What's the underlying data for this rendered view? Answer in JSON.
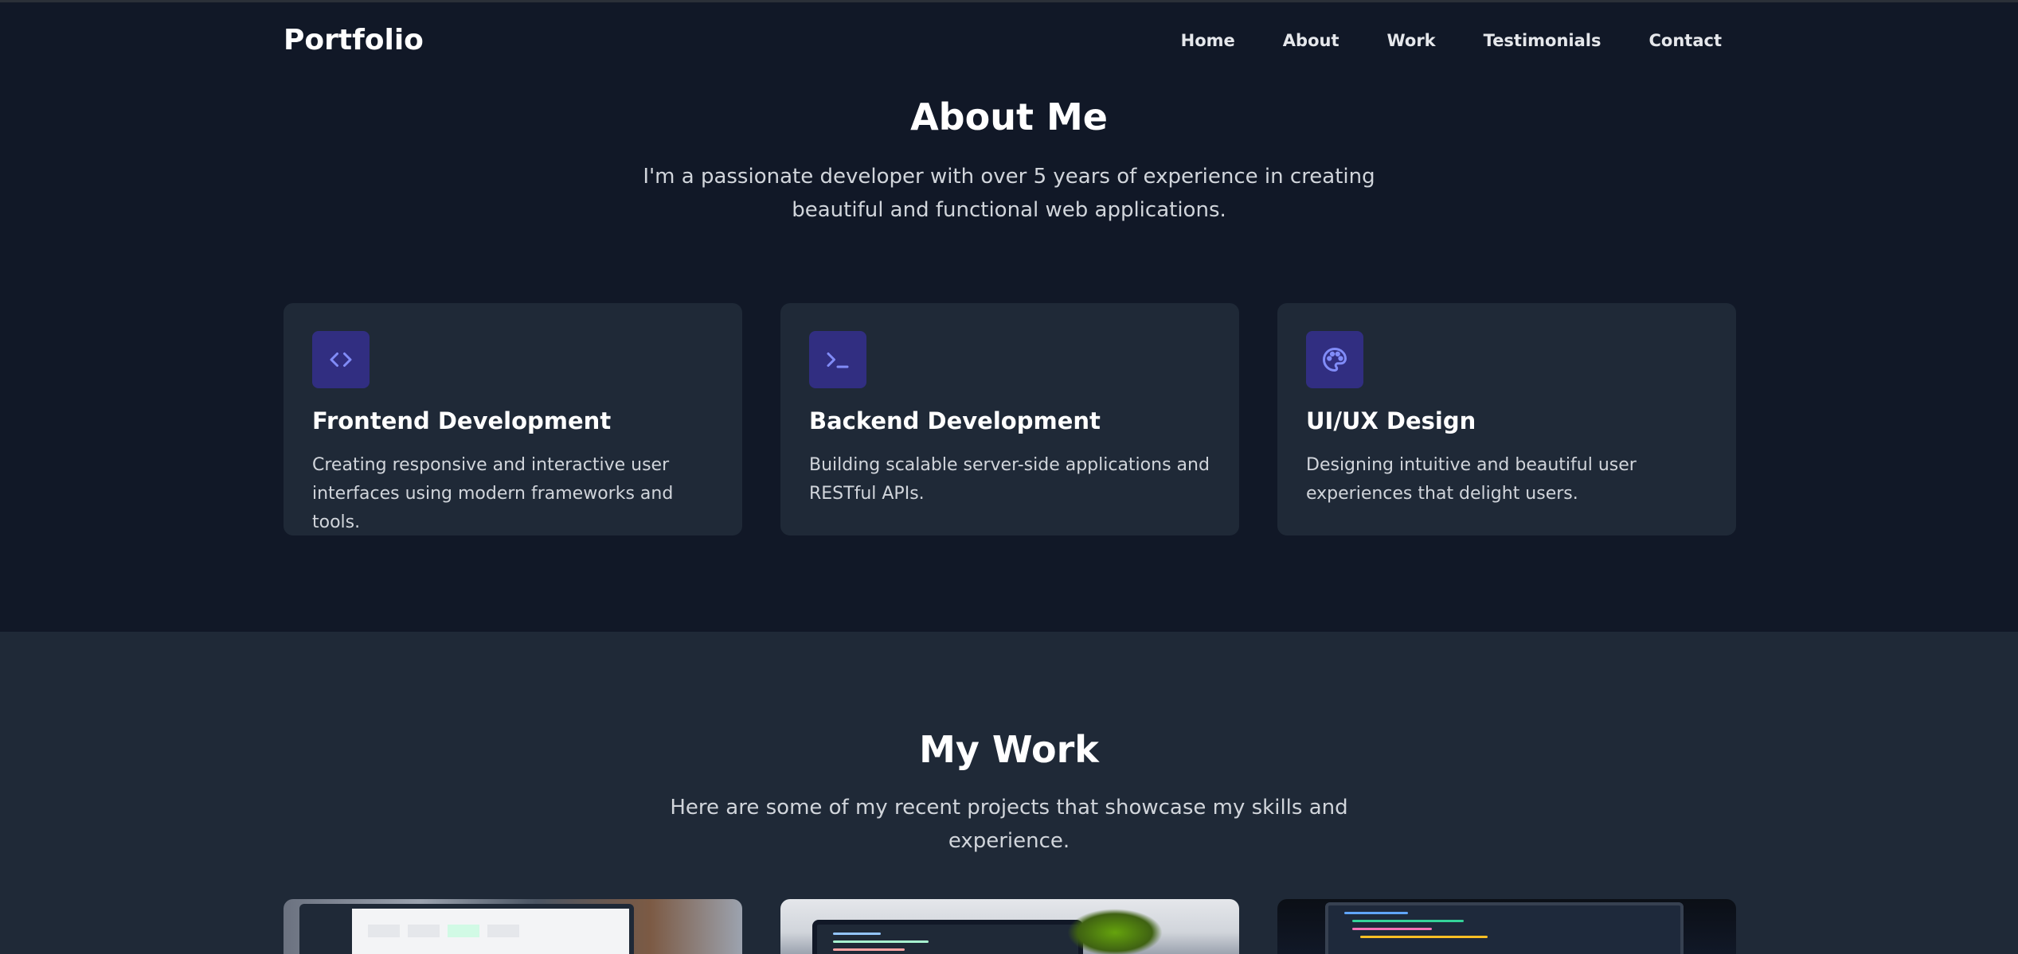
{
  "nav": {
    "brand": "Portfolio",
    "links": [
      "Home",
      "About",
      "Work",
      "Testimonials",
      "Contact"
    ]
  },
  "about": {
    "title": "About Me",
    "subtitle": "I'm a passionate developer with over 5 years of experience in creating beautiful and functional web applications.",
    "cards": [
      {
        "icon": "code-icon",
        "title": "Frontend Development",
        "description": "Creating responsive and interactive user interfaces using modern frameworks and tools."
      },
      {
        "icon": "terminal-icon",
        "title": "Backend Development",
        "description": "Building scalable server-side applications and RESTful APIs."
      },
      {
        "icon": "palette-icon",
        "title": "UI/UX Design",
        "description": "Designing intuitive and beautiful user experiences that delight users."
      }
    ]
  },
  "work": {
    "title": "My Work",
    "subtitle": "Here are some of my recent projects that showcase my skills and experience."
  },
  "colors": {
    "page_bg": "#111827",
    "section_alt_bg": "#1f2937",
    "card_bg": "#1f2937",
    "icon_bg": "#312e81",
    "icon_fg": "#818cf8",
    "text_primary": "#ffffff",
    "text_secondary": "#d1d5db"
  }
}
